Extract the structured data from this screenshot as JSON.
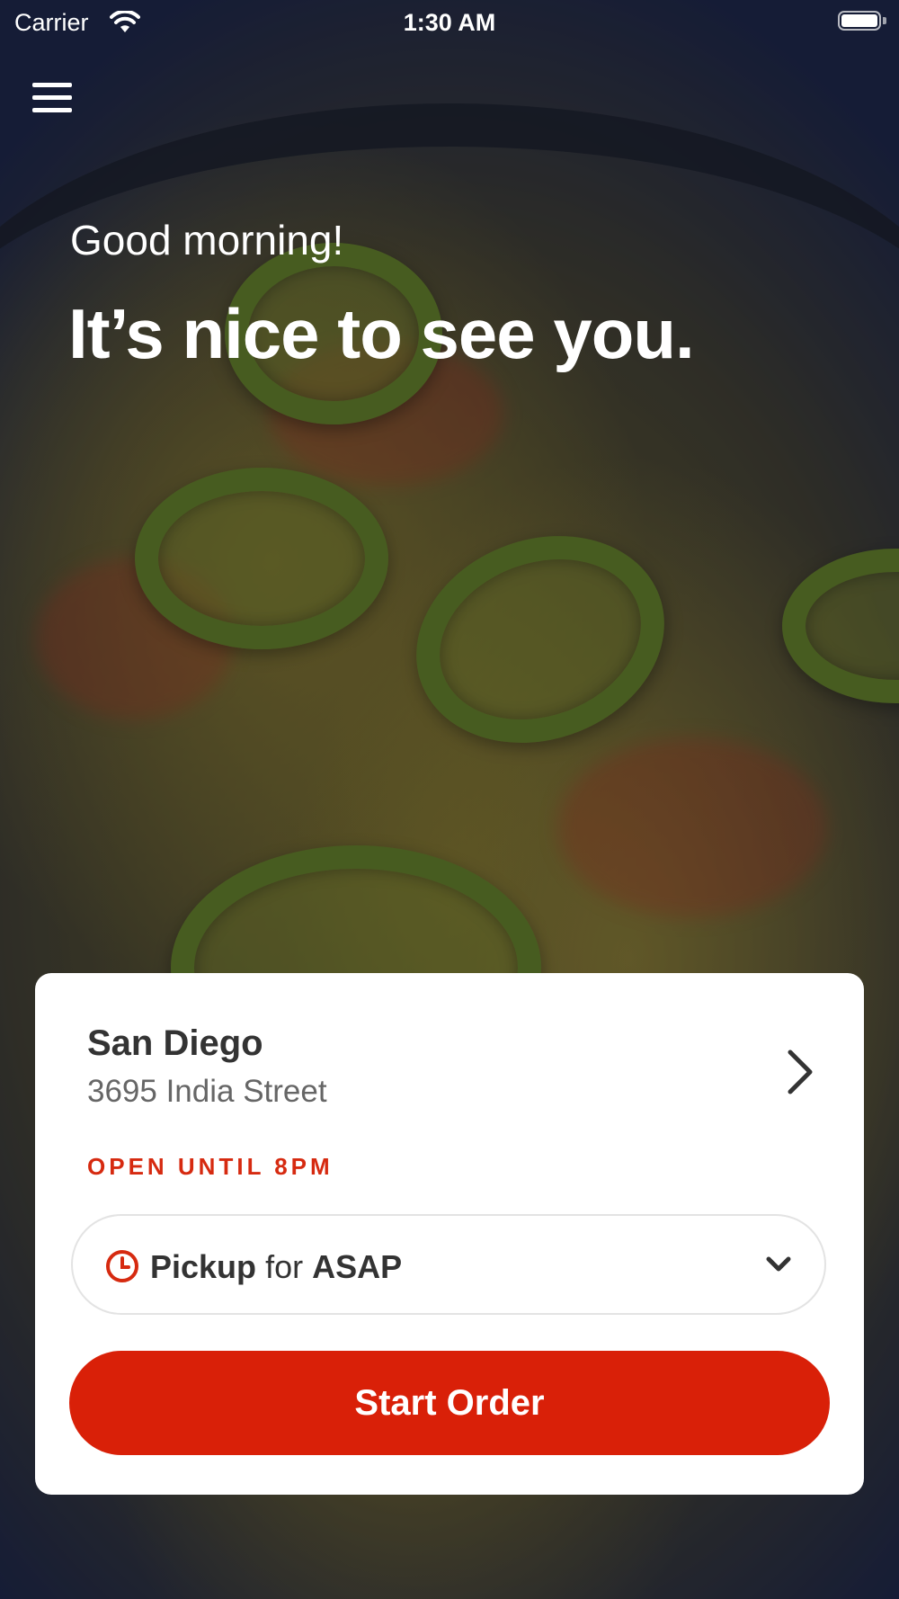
{
  "status_bar": {
    "carrier": "Carrier",
    "time": "1:30 AM"
  },
  "header": {
    "menu_icon": "hamburger-menu-icon"
  },
  "hero": {
    "greeting": "Good morning!",
    "headline": "It’s nice to see you."
  },
  "location_card": {
    "name": "San Diego",
    "address": "3695 India Street",
    "hours_status": "OPEN UNTIL 8PM",
    "pickup": {
      "mode": "Pickup",
      "connector": "for",
      "time": "ASAP"
    },
    "start_order_label": "Start Order"
  },
  "colors": {
    "accent": "#d92008",
    "status_text": "#d62a10"
  }
}
